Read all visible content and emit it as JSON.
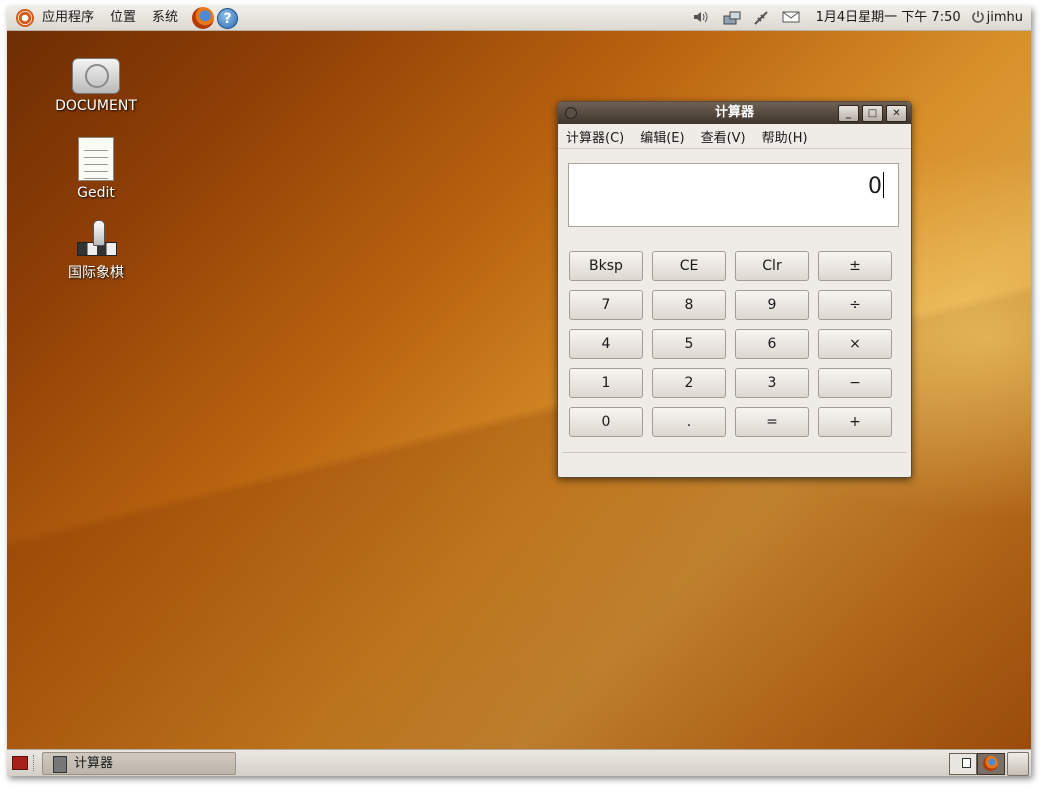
{
  "top_panel": {
    "menus": [
      "应用程序",
      "位置",
      "系统"
    ],
    "clock": "1月4日星期一 下午 7:50",
    "user": "jimhu"
  },
  "desktop_icons": [
    {
      "label": "DOCUMENT",
      "icon": "drive-icon"
    },
    {
      "label": "Gedit",
      "icon": "text-editor-icon"
    },
    {
      "label": "国际象棋",
      "icon": "chess-icon"
    }
  ],
  "calculator": {
    "title": "计算器",
    "menus": [
      "计算器(C)",
      "编辑(E)",
      "查看(V)",
      "帮助(H)"
    ],
    "display_value": "0",
    "buttons": [
      [
        "Bksp",
        "CE",
        "Clr",
        "±"
      ],
      [
        "7",
        "8",
        "9",
        "÷"
      ],
      [
        "4",
        "5",
        "6",
        "×"
      ],
      [
        "1",
        "2",
        "3",
        "−"
      ],
      [
        "0",
        ".",
        "=",
        "+"
      ]
    ]
  },
  "bottom_panel": {
    "task_label": "计算器"
  }
}
